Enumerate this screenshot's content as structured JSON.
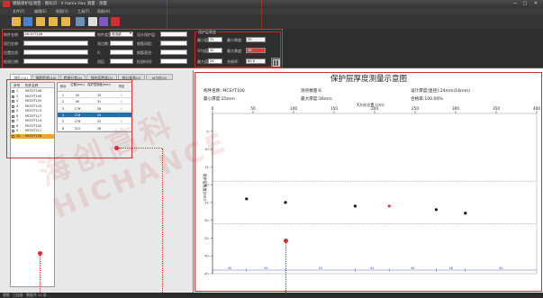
{
  "app": {
    "title": "钢筋保护层测量 · 图标识 · V Hanix Hax 测量 · 测量",
    "colors": {
      "accent": "#d32f2f",
      "selected_row": "#1f6fb3",
      "list_selected": "#f4a623",
      "panel_dark": "#2e2e2e"
    }
  },
  "window_controls": {
    "minimize": "—",
    "maximize": "□",
    "close": "✕"
  },
  "menu": [
    "文件(F)",
    "编辑(E)",
    "视图(V)",
    "工具(T)",
    "帮助(H)"
  ],
  "toolbar": {
    "icons": [
      "open-folder-icon",
      "save-icon",
      "import-icon",
      "export-icon",
      "folder-icon",
      "print-icon",
      "report-icon",
      "chart-icon",
      "close-icon"
    ]
  },
  "form": {
    "component_name_label": "构件名称:",
    "component_name_value": "MCSYT106",
    "component_type_label": "构件类型:",
    "component_type_value": "现浇梁",
    "design_thickness_label": "设计保护层:",
    "design_thickness_value": "",
    "project_name_label": "项目名称:",
    "project_name_value": "",
    "rebar_count_label": "测点数:",
    "rebar_count_value": "",
    "rebar_spacing_label": "钢筋间距:",
    "rebar_spacing_value": "",
    "position_label": "位置信息:",
    "position_value": "",
    "x_label": "X:",
    "x_value": "",
    "diameter_label": "钢筋直径:",
    "diameter_value": "",
    "inspector_label": "检测日期:",
    "inspector_value": "",
    "batch_label": "测区:",
    "batch_value": "",
    "date_label": "检测时间:",
    "date_value": ""
  },
  "thickness_group": {
    "title": "保护层厚度",
    "min_design_label": "最小值:",
    "min_design_value": "25",
    "min_measured_label": "最小厚度:",
    "min_measured_value": "25",
    "avg_design_label": "平均值:",
    "avg_design_value": "30",
    "avg_measured_label": "最大厚度:",
    "avg_measured_value": "36",
    "max_design_label": "最大值:",
    "max_design_value": "26",
    "max_measured_label": "合格率:",
    "max_measured_value": "80.0"
  },
  "left_tabs": [
    "测区(10)",
    "钢筋检测(10)",
    "检测分类(4)",
    "保护层检测(3)",
    "统计报表(4)",
    "AI分析(0)"
  ],
  "component_list": {
    "headers": [
      "序号",
      "构件名称"
    ],
    "rows": [
      {
        "no": "1",
        "name": "MCSYT106",
        "checked": false
      },
      {
        "no": "2",
        "name": "MCSYT109",
        "checked": false
      },
      {
        "no": "3",
        "name": "MCSYT105",
        "checked": false
      },
      {
        "no": "4",
        "name": "MCSYT120",
        "checked": false
      },
      {
        "no": "5",
        "name": "MCSYT113",
        "checked": false
      },
      {
        "no": "6",
        "name": "MCSYT117",
        "checked": false
      },
      {
        "no": "7",
        "name": "MCSYT114",
        "checked": false
      },
      {
        "no": "8",
        "name": "MCSYT102",
        "checked": false
      },
      {
        "no": "9",
        "name": "MCSYT111",
        "checked": false
      },
      {
        "no": "10",
        "name": "MCSYT106",
        "checked": true
      }
    ]
  },
  "measure_table": {
    "headers": [
      "测点",
      "位置(mm)",
      "保护层厚度(mm)",
      "判定"
    ],
    "rows": [
      {
        "no": "1",
        "pos": "42",
        "val": "33",
        "ok": "√"
      },
      {
        "no": "2",
        "pos": "90",
        "val": "31",
        "ok": "√"
      },
      {
        "no": "3",
        "pos": "176",
        "val": "28",
        "ok": "√"
      },
      {
        "no": "4",
        "pos": "218",
        "val": "34",
        "ok": "√"
      },
      {
        "no": "5",
        "pos": "276",
        "val": "25",
        "ok": "√"
      },
      {
        "no": "6",
        "pos": "312",
        "val": "26",
        "ok": "√"
      }
    ],
    "selected_index": 3
  },
  "chart_info": {
    "title": "保护层厚度测量示意图",
    "component": "构件名称: MCSYT106",
    "point_count": "测点数量:6",
    "design_thickness": "设计厚度(直径):24mm(16mm)",
    "min_thickness": "最小厚度:25mm",
    "max_thickness": "最大厚度:36mm",
    "pass_rate": "合格率:100.00%",
    "xlabel": "X方向位置 (cm)",
    "ylabel": "保护层厚度(mm)"
  },
  "chart_data": {
    "type": "scatter",
    "xlabel": "X方向位置 (cm)",
    "ylabel": "保护层厚度(mm)",
    "xlim": [
      0,
      400
    ],
    "ylim": [
      0,
      45
    ],
    "x_ticks": [
      0,
      50,
      100,
      150,
      200,
      250,
      300,
      350,
      400
    ],
    "y_ticks": [
      5,
      10,
      15,
      20,
      25,
      30,
      35,
      40,
      45
    ],
    "threshold_lines": [
      19,
      31
    ],
    "series": [
      {
        "x": [
          42,
          90,
          176,
          218,
          276,
          312
        ],
        "y": [
          24,
          25,
          26,
          26,
          27,
          28
        ],
        "highlight_index": 3
      }
    ],
    "segment_labels": [
      "40",
      "50",
      "50",
      "42",
      "58",
      "36",
      "30"
    ]
  },
  "status": {
    "text": "就绪 · 已连接 · 数据共 10 条"
  }
}
